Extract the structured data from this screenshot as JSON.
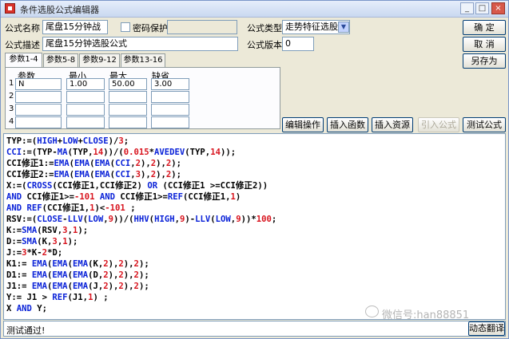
{
  "window": {
    "title": "条件选股公式编辑器",
    "controls": [
      "_",
      "□",
      "×"
    ]
  },
  "form": {
    "name_label": "公式名称",
    "name_value": "尾盘15分钟战",
    "password_label": "密码保护",
    "type_label": "公式类型",
    "type_value": "走势特征选股",
    "desc_label": "公式描述",
    "desc_value": "尾盘15分钟选股公式",
    "version_label": "公式版本",
    "version_value": "0"
  },
  "buttons": {
    "ok": "确  定",
    "cancel": "取  消",
    "save_as": "另存为",
    "edit_ops": "编辑操作",
    "insert_func": "插入函数",
    "insert_res": "插入资源",
    "import_formula": "引入公式",
    "test_formula": "测试公式",
    "translate": "动态翻译"
  },
  "tabs": [
    "参数1-4",
    "参数5-8",
    "参数9-12",
    "参数13-16"
  ],
  "params": {
    "headers": [
      "参数",
      "最小",
      "最大",
      "缺省"
    ],
    "rows": [
      {
        "num": "1",
        "name": "N",
        "min": "1.00",
        "max": "50.00",
        "def": "3.00"
      },
      {
        "num": "2",
        "name": "",
        "min": "",
        "max": "",
        "def": ""
      },
      {
        "num": "3",
        "name": "",
        "min": "",
        "max": "",
        "def": ""
      },
      {
        "num": "4",
        "name": "",
        "min": "",
        "max": "",
        "def": ""
      }
    ]
  },
  "code_lines": [
    [
      [
        "TYP:=(",
        "k"
      ],
      [
        "HIGH",
        "b"
      ],
      [
        "+",
        "k"
      ],
      [
        "LOW",
        "b"
      ],
      [
        "+",
        "k"
      ],
      [
        "CLOSE",
        "b"
      ],
      [
        ")/",
        "k"
      ],
      [
        "3",
        "r"
      ],
      [
        ";",
        "k"
      ]
    ],
    [
      [
        "CCI",
        "b"
      ],
      [
        ":=(TYP-",
        "k"
      ],
      [
        "MA",
        "b"
      ],
      [
        "(TYP,",
        "k"
      ],
      [
        "14",
        "r"
      ],
      [
        "))/(",
        "k"
      ],
      [
        "0.015",
        "r"
      ],
      [
        "*",
        "k"
      ],
      [
        "AVEDEV",
        "b"
      ],
      [
        "(TYP,",
        "k"
      ],
      [
        "14",
        "r"
      ],
      [
        "));",
        "k"
      ]
    ],
    [
      [
        "CCI修正1:=",
        "k"
      ],
      [
        "EMA",
        "b"
      ],
      [
        "(",
        "k"
      ],
      [
        "EMA",
        "b"
      ],
      [
        "(",
        "k"
      ],
      [
        "EMA",
        "b"
      ],
      [
        "(",
        "k"
      ],
      [
        "CCI",
        "b"
      ],
      [
        ",",
        "k"
      ],
      [
        "2",
        "r"
      ],
      [
        "),",
        "k"
      ],
      [
        "2",
        "r"
      ],
      [
        "),",
        "k"
      ],
      [
        "2",
        "r"
      ],
      [
        ");",
        "k"
      ]
    ],
    [
      [
        "CCI修正2:=",
        "k"
      ],
      [
        "EMA",
        "b"
      ],
      [
        "(",
        "k"
      ],
      [
        "EMA",
        "b"
      ],
      [
        "(",
        "k"
      ],
      [
        "EMA",
        "b"
      ],
      [
        "(",
        "k"
      ],
      [
        "CCI",
        "b"
      ],
      [
        ",",
        "k"
      ],
      [
        "3",
        "r"
      ],
      [
        "),",
        "k"
      ],
      [
        "2",
        "r"
      ],
      [
        "),",
        "k"
      ],
      [
        "2",
        "r"
      ],
      [
        ");",
        "k"
      ]
    ],
    [
      [
        "X:=(",
        "k"
      ],
      [
        "CROSS",
        "b"
      ],
      [
        "(CCI修正1,CCI修正2) ",
        "k"
      ],
      [
        "OR",
        "b"
      ],
      [
        " (CCI修正1 >=CCI修正2))",
        "k"
      ]
    ],
    [
      [
        "AND",
        "b"
      ],
      [
        " CCI修正1>=",
        "k"
      ],
      [
        "-101",
        "r"
      ],
      [
        " ",
        "k"
      ],
      [
        "AND",
        "b"
      ],
      [
        " CCI修正1>=",
        "k"
      ],
      [
        "REF",
        "b"
      ],
      [
        "(CCI修正1,",
        "k"
      ],
      [
        "1",
        "r"
      ],
      [
        ")",
        "k"
      ]
    ],
    [
      [
        "AND",
        "b"
      ],
      [
        " ",
        "k"
      ],
      [
        "REF",
        "b"
      ],
      [
        "(CCI修正1,",
        "k"
      ],
      [
        "1",
        "r"
      ],
      [
        ")<",
        "k"
      ],
      [
        "-101",
        "r"
      ],
      [
        " ;",
        "k"
      ]
    ],
    [
      [
        "RSV:=(",
        "k"
      ],
      [
        "CLOSE",
        "b"
      ],
      [
        "-",
        "k"
      ],
      [
        "LLV",
        "b"
      ],
      [
        "(",
        "k"
      ],
      [
        "LOW",
        "b"
      ],
      [
        ",",
        "k"
      ],
      [
        "9",
        "r"
      ],
      [
        "))/(",
        "k"
      ],
      [
        "HHV",
        "b"
      ],
      [
        "(",
        "k"
      ],
      [
        "HIGH",
        "b"
      ],
      [
        ",",
        "k"
      ],
      [
        "9",
        "r"
      ],
      [
        ")-",
        "k"
      ],
      [
        "LLV",
        "b"
      ],
      [
        "(",
        "k"
      ],
      [
        "LOW",
        "b"
      ],
      [
        ",",
        "k"
      ],
      [
        "9",
        "r"
      ],
      [
        "))*",
        "k"
      ],
      [
        "100",
        "r"
      ],
      [
        ";",
        "k"
      ]
    ],
    [
      [
        "K:=",
        "k"
      ],
      [
        "SMA",
        "b"
      ],
      [
        "(RSV,",
        "k"
      ],
      [
        "3",
        "r"
      ],
      [
        ",",
        "k"
      ],
      [
        "1",
        "r"
      ],
      [
        ");",
        "k"
      ]
    ],
    [
      [
        "D:=",
        "k"
      ],
      [
        "SMA",
        "b"
      ],
      [
        "(K,",
        "k"
      ],
      [
        "3",
        "r"
      ],
      [
        ",",
        "k"
      ],
      [
        "1",
        "r"
      ],
      [
        ");",
        "k"
      ]
    ],
    [
      [
        "J:=",
        "k"
      ],
      [
        "3",
        "r"
      ],
      [
        "*K-",
        "k"
      ],
      [
        "2",
        "r"
      ],
      [
        "*D;",
        "k"
      ]
    ],
    [
      [
        "K1:= ",
        "k"
      ],
      [
        "EMA",
        "b"
      ],
      [
        "(",
        "k"
      ],
      [
        "EMA",
        "b"
      ],
      [
        "(",
        "k"
      ],
      [
        "EMA",
        "b"
      ],
      [
        "(K,",
        "k"
      ],
      [
        "2",
        "r"
      ],
      [
        "),",
        "k"
      ],
      [
        "2",
        "r"
      ],
      [
        "),",
        "k"
      ],
      [
        "2",
        "r"
      ],
      [
        ");",
        "k"
      ]
    ],
    [
      [
        "D1:= ",
        "k"
      ],
      [
        "EMA",
        "b"
      ],
      [
        "(",
        "k"
      ],
      [
        "EMA",
        "b"
      ],
      [
        "(",
        "k"
      ],
      [
        "EMA",
        "b"
      ],
      [
        "(D,",
        "k"
      ],
      [
        "2",
        "r"
      ],
      [
        "),",
        "k"
      ],
      [
        "2",
        "r"
      ],
      [
        "),",
        "k"
      ],
      [
        "2",
        "r"
      ],
      [
        ");",
        "k"
      ]
    ],
    [
      [
        "J1:= ",
        "k"
      ],
      [
        "EMA",
        "b"
      ],
      [
        "(",
        "k"
      ],
      [
        "EMA",
        "b"
      ],
      [
        "(",
        "k"
      ],
      [
        "EMA",
        "b"
      ],
      [
        "(J,",
        "k"
      ],
      [
        "2",
        "r"
      ],
      [
        "),",
        "k"
      ],
      [
        "2",
        "r"
      ],
      [
        "),",
        "k"
      ],
      [
        "2",
        "r"
      ],
      [
        ");",
        "k"
      ]
    ],
    [
      [
        "Y:= J1 > ",
        "k"
      ],
      [
        "REF",
        "b"
      ],
      [
        "(J1,",
        "k"
      ],
      [
        "1",
        "r"
      ],
      [
        ") ;",
        "k"
      ]
    ],
    [
      [
        "X ",
        "k"
      ],
      [
        "AND",
        "b"
      ],
      [
        " Y;",
        "k"
      ]
    ]
  ],
  "status": {
    "text": "测试通过!"
  },
  "watermark": {
    "text": "微信号:han88851"
  }
}
